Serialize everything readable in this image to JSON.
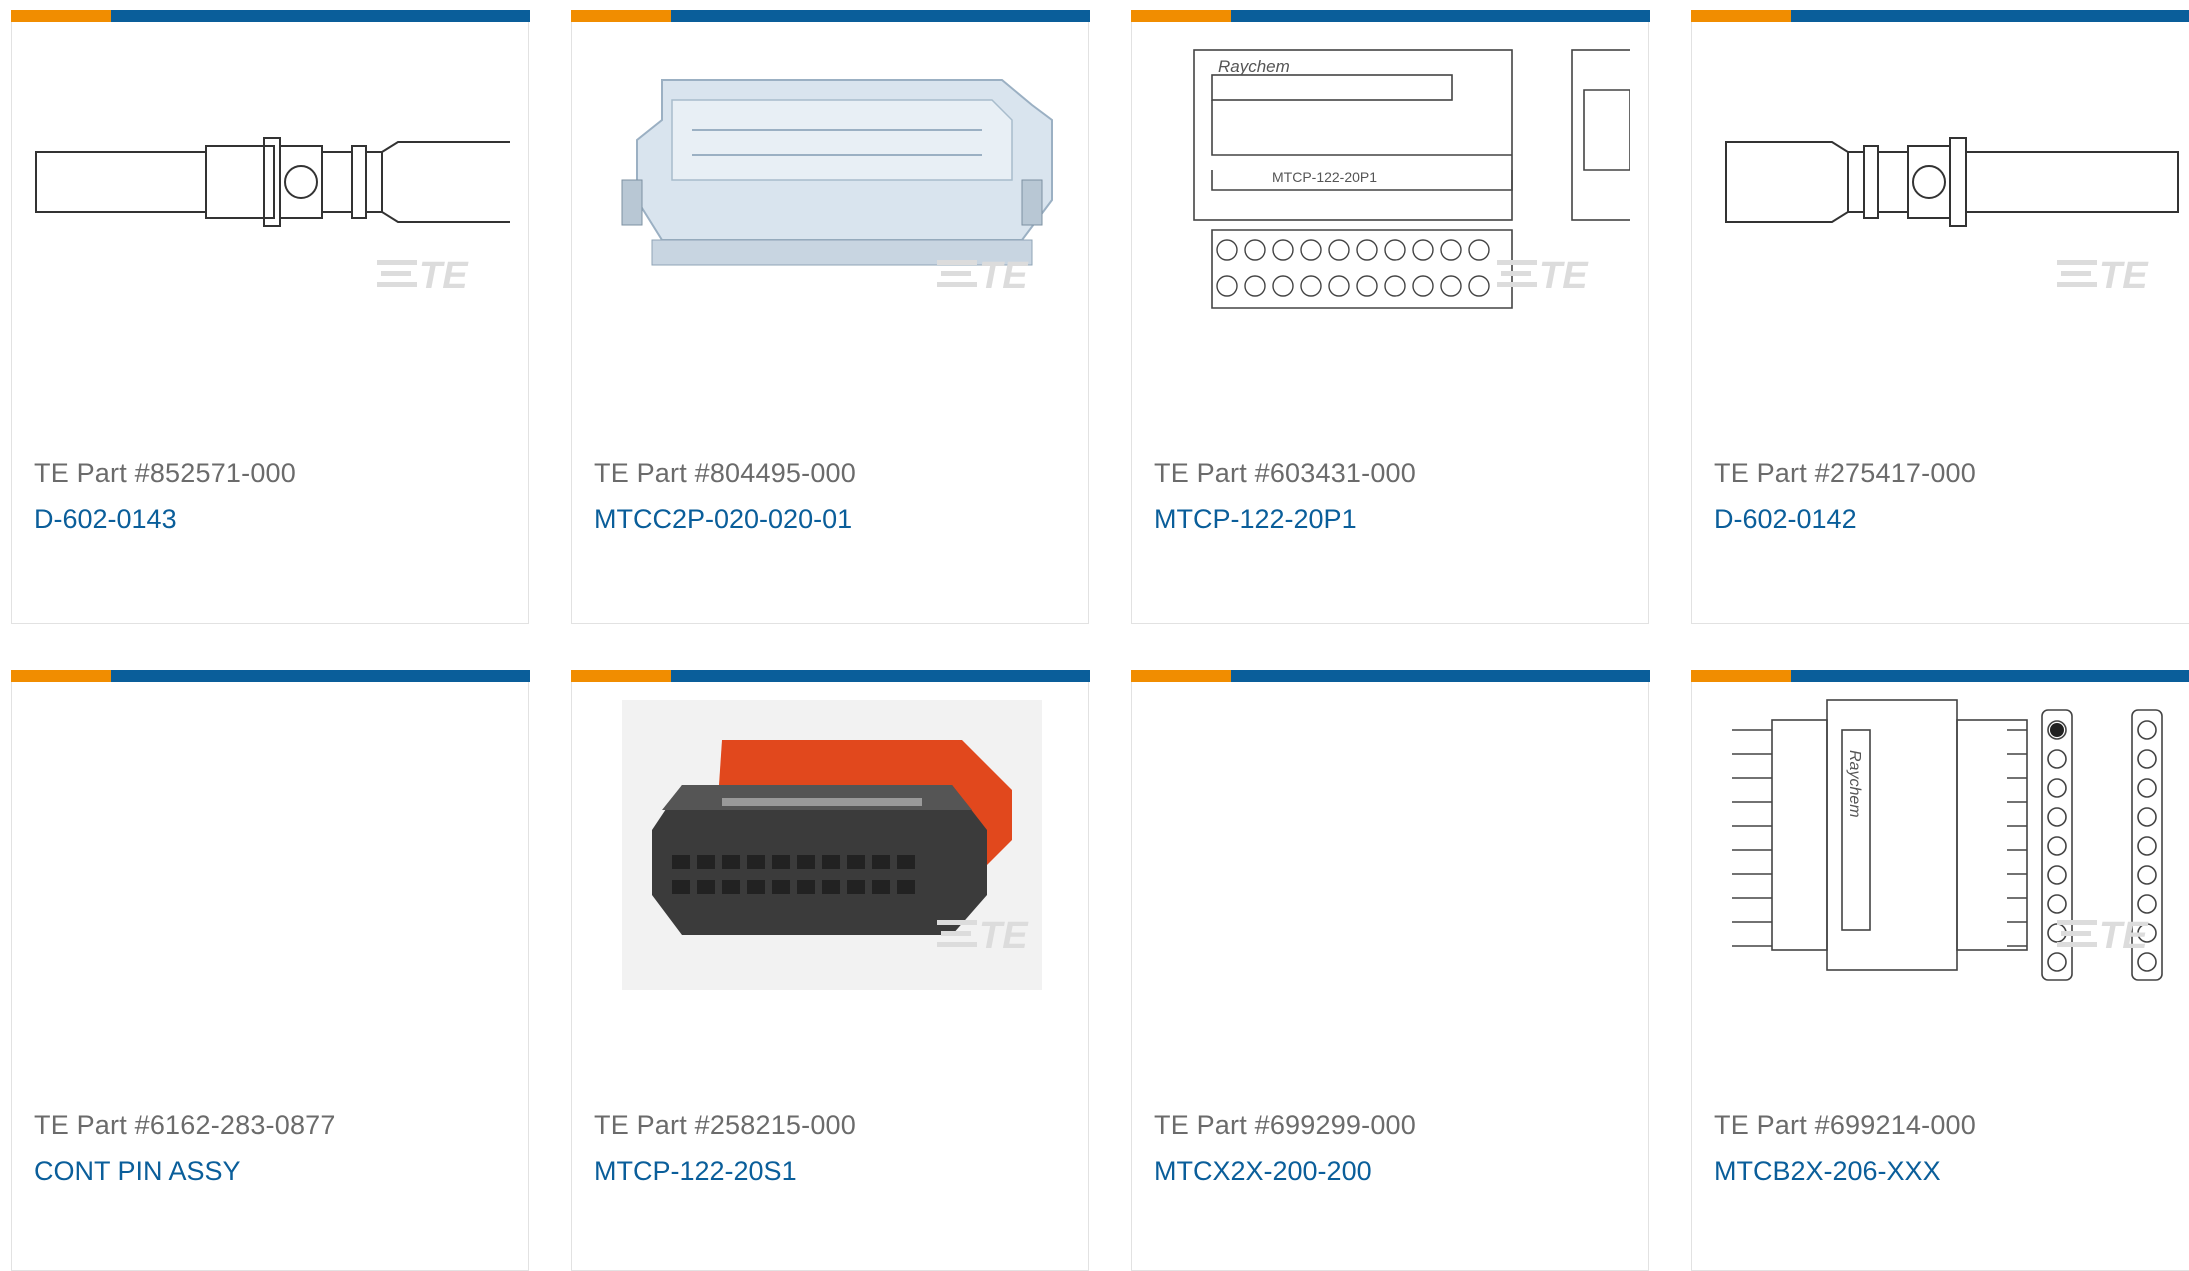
{
  "colors": {
    "accent_orange": "#f18d00",
    "accent_blue": "#0a5e9a",
    "link": "#0a5e9a",
    "muted_text": "#6b6b6b"
  },
  "products": [
    {
      "part": "TE Part #852571-000",
      "name": "D-602-0143",
      "image": "pin-contact-drawing"
    },
    {
      "part": "TE Part #804495-000",
      "name": "MTCC2P-020-020-01",
      "image": "connector-cover-render"
    },
    {
      "part": "TE Part #603431-000",
      "name": "MTCP-122-20P1",
      "image": "connector-plug-drawing",
      "image_text": [
        "Raychem",
        "MTCP-122-20P1"
      ]
    },
    {
      "part": "TE Part #275417-000",
      "name": "D-602-0142",
      "image": "pin-contact-drawing"
    },
    {
      "part": "TE Part #6162-283-0877",
      "name": "CONT PIN ASSY",
      "image": "none"
    },
    {
      "part": "TE Part #258215-000",
      "name": "MTCP-122-20S1",
      "image": "socket-connector-render"
    },
    {
      "part": "TE Part #699299-000",
      "name": "MTCX2X-200-200",
      "image": "none"
    },
    {
      "part": "TE Part #699214-000",
      "name": "MTCB2X-206-XXX",
      "image": "connector-block-drawing",
      "image_text": [
        "Raychem"
      ]
    }
  ]
}
